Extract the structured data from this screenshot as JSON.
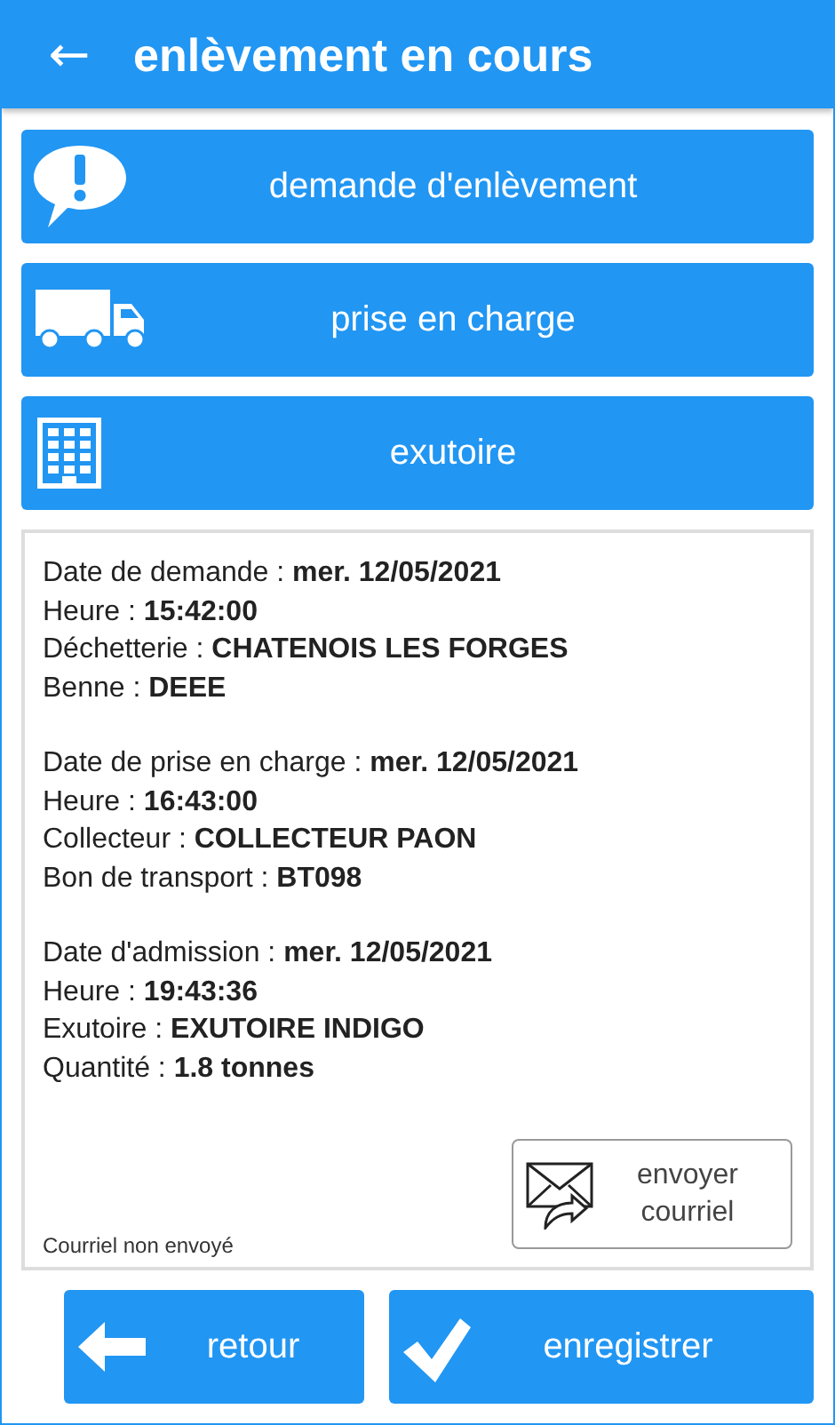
{
  "app_bar": {
    "back_icon": "←",
    "title": "enlèvement en cours"
  },
  "sections": [
    {
      "label": "demande d'enlèvement",
      "kind": "alert"
    },
    {
      "label": "prise en charge",
      "kind": "truck"
    },
    {
      "label": "exutoire",
      "kind": "building"
    }
  ],
  "details": [
    [
      "Date de demande : **mer. 12/05/2021**",
      "Heure : **15:42:00**",
      "Déchetterie : **CHATENOIS LES FORGES**",
      "Benne : **DEEE**"
    ],
    [
      "Date de prise en charge : **mer. 12/05/2021**",
      "Heure : **16:43:00**",
      "Collecteur : **COLLECTEUR PAON**",
      "Bon de transport : **BT098**"
    ],
    [
      "Date d'admission : **mer. 12/05/2021**",
      "Heure : **19:43:36**",
      "Exutoire : **EXUTOIRE INDIGO**",
      "Quantité : **1.8 tonnes**"
    ]
  ],
  "email_status": "Courriel non envoyé",
  "email_button": {
    "label_lines": [
      "envoyer",
      "courriel"
    ]
  },
  "footer_buttons": [
    {
      "label": "retour",
      "kind": "back"
    },
    {
      "label": "enregistrer",
      "kind": "check"
    }
  ]
}
